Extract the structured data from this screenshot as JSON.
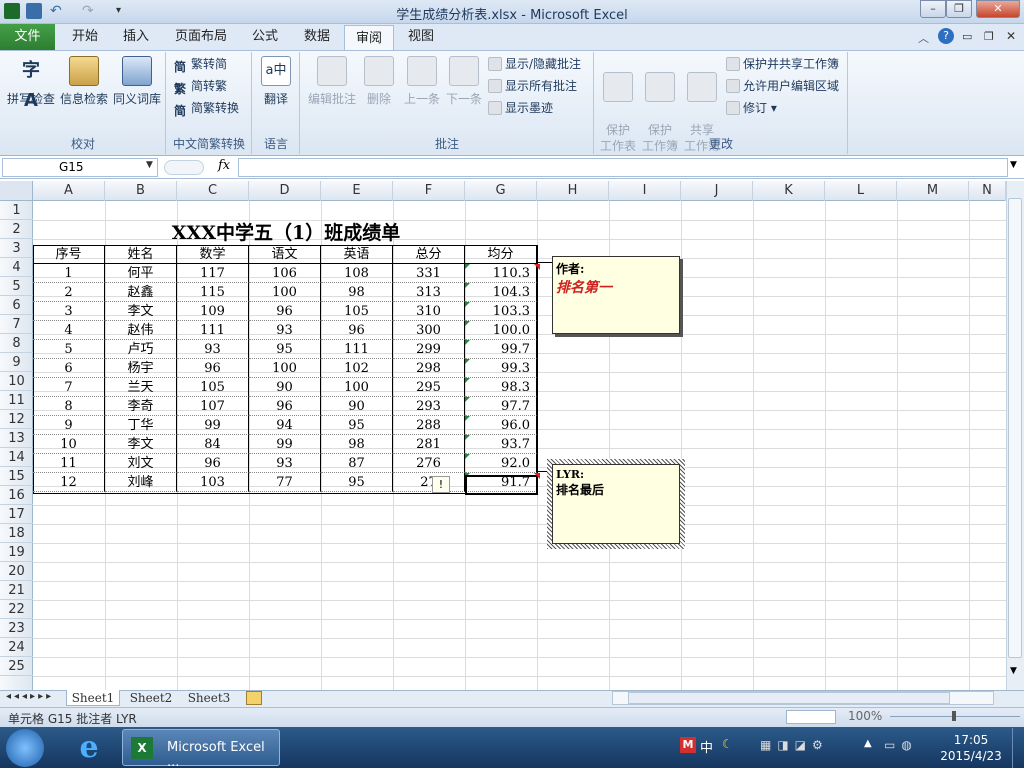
{
  "window": {
    "title": "学生成绩分析表.xlsx - Microsoft Excel"
  },
  "menu": {
    "file": "文件",
    "tabs": [
      "开始",
      "插入",
      "页面布局",
      "公式",
      "数据",
      "审阅",
      "视图"
    ]
  },
  "ribbon": {
    "proofing": {
      "spell": "拼写检查",
      "research": "信息检索",
      "thesaurus": "同义词库",
      "label": "校对"
    },
    "chinese": {
      "t2s": "繁转简",
      "s2t": "简转繁",
      "convert": "简繁转换",
      "label": "中文简繁转换"
    },
    "language": {
      "translate": "翻译",
      "label": "语言"
    },
    "comments": {
      "edit": "编辑批注",
      "delete": "删除",
      "prev": "上一条",
      "next": "下一条",
      "show_hide": "显示/隐藏批注",
      "show_all": "显示所有批注",
      "show_ink": "显示墨迹",
      "label": "批注"
    },
    "changes": {
      "protect_sheet": "保护\n工作表",
      "protect_wb": "保护\n工作簿",
      "share_wb": "共享\n工作簿",
      "protect_share": "保护并共享工作簿",
      "allow_edit": "允许用户编辑区域",
      "track": "修订",
      "label": "更改"
    }
  },
  "formula": {
    "namebox": "G15",
    "fx": "fx",
    "value": ""
  },
  "columns": [
    "A",
    "B",
    "C",
    "D",
    "E",
    "F",
    "G",
    "H",
    "I",
    "J",
    "K",
    "L",
    "M",
    "N"
  ],
  "rows": [
    "1",
    "2",
    "3",
    "4",
    "5",
    "6",
    "7",
    "8",
    "9",
    "10",
    "11",
    "12",
    "13",
    "14",
    "15",
    "16",
    "17",
    "18",
    "19",
    "20",
    "21",
    "22",
    "23",
    "24",
    "25"
  ],
  "sheet": {
    "title": "XXX中学五（1）班成绩单",
    "headers": [
      "序号",
      "姓名",
      "数学",
      "语文",
      "英语",
      "总分",
      "均分"
    ],
    "data": [
      [
        "1",
        "何平",
        "117",
        "106",
        "108",
        "331",
        "110.3"
      ],
      [
        "2",
        "赵鑫",
        "115",
        "100",
        "98",
        "313",
        "104.3"
      ],
      [
        "3",
        "李文",
        "109",
        "96",
        "105",
        "310",
        "103.3"
      ],
      [
        "4",
        "赵伟",
        "111",
        "93",
        "96",
        "300",
        "100.0"
      ],
      [
        "5",
        "卢巧",
        "93",
        "95",
        "111",
        "299",
        "99.7"
      ],
      [
        "6",
        "杨宇",
        "96",
        "100",
        "102",
        "298",
        "99.3"
      ],
      [
        "7",
        "兰天",
        "105",
        "90",
        "100",
        "295",
        "98.3"
      ],
      [
        "8",
        "李奇",
        "107",
        "96",
        "90",
        "293",
        "97.7"
      ],
      [
        "9",
        "丁华",
        "99",
        "94",
        "95",
        "288",
        "96.0"
      ],
      [
        "10",
        "李文",
        "84",
        "99",
        "98",
        "281",
        "93.7"
      ],
      [
        "11",
        "刘文",
        "96",
        "93",
        "87",
        "276",
        "92.0"
      ],
      [
        "12",
        "刘峰",
        "103",
        "77",
        "95",
        "27",
        "91.7"
      ]
    ]
  },
  "comments": [
    {
      "author": "作者:",
      "text": "排名第一"
    },
    {
      "author": "LYR:",
      "text": "排名最后"
    }
  ],
  "sheettabs": [
    "Sheet1",
    "Sheet2",
    "Sheet3"
  ],
  "status": {
    "text": "单元格 G15 批注者 LYR",
    "zoom": "100%"
  },
  "taskbar": {
    "app": "Microsoft Excel ...",
    "ime": "中",
    "time": "17:05",
    "date": "2015/4/23"
  }
}
